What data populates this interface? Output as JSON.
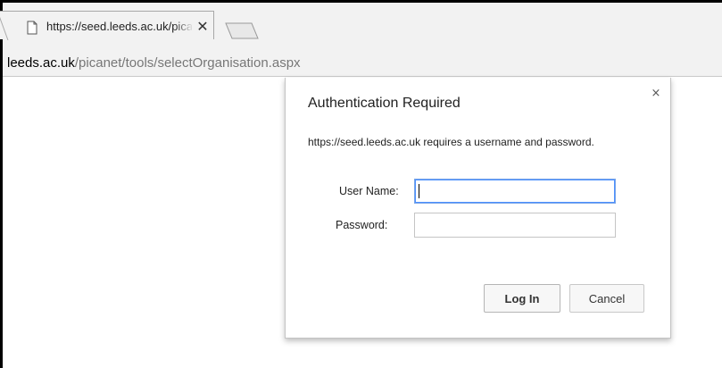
{
  "browser": {
    "tab": {
      "title": "https://seed.leeds.ac.uk/picanet/tools/selectOrganisation.aspx",
      "close_glyph": "✕",
      "favicon": "page-icon"
    },
    "new_tab_icon": "new-tab-icon",
    "address": {
      "host": "leeds.ac.uk",
      "path": "/picanet/tools/selectOrganisation.aspx"
    }
  },
  "auth_dialog": {
    "title": "Authentication Required",
    "close_glyph": "×",
    "message": "https://seed.leeds.ac.uk requires a username and password.",
    "username_label": "User Name:",
    "username_value": "",
    "password_label": "Password:",
    "password_value": "",
    "login_label": "Log In",
    "cancel_label": "Cancel"
  },
  "colors": {
    "focus_border": "#4d90fe",
    "chrome_bg": "#f2f2f2"
  }
}
